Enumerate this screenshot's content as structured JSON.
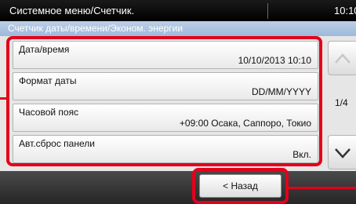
{
  "titlebar": {
    "title": "Системное меню/Счетчик.",
    "clock": "10:10"
  },
  "subtitle": "Счетчик даты/времени/Эконом. энергии",
  "items": [
    {
      "label": "Дата/время",
      "value": "10/10/2013 10:10"
    },
    {
      "label": "Формат даты",
      "value": "DD/MM/YYYY"
    },
    {
      "label": "Часовой пояс",
      "value": "+09:00 Осака, Саппоро, Токио"
    },
    {
      "label": "Авт.сброс панели",
      "value": "Вкл."
    }
  ],
  "pagination": {
    "indicator": "1/4"
  },
  "icons": {
    "scroll_up": "chevron-up-icon",
    "scroll_down": "chevron-down-icon"
  },
  "footer": {
    "back_label": "< Назад"
  },
  "colors": {
    "highlight": "#e3001b",
    "subtitle_bar": "#9fb9da",
    "titlebar": "#000000",
    "footer_bar": "#333333"
  }
}
